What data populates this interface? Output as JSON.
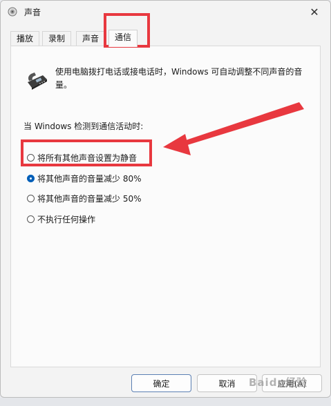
{
  "window": {
    "title": "声音",
    "close_glyph": "✕"
  },
  "tabs": [
    {
      "label": "播放"
    },
    {
      "label": "录制"
    },
    {
      "label": "声音"
    },
    {
      "label": "通信",
      "active": true
    }
  ],
  "panel": {
    "description": "使用电脑拨打电话或接电话时，Windows 可自动调整不同声音的音量。",
    "detect_label": "当 Windows 检测到通信活动时:",
    "options": [
      {
        "label": "将所有其他声音设置为静音",
        "checked": false
      },
      {
        "label": "将其他声音的音量减少 80%",
        "checked": true
      },
      {
        "label": "将其他声音的音量减少 50%",
        "checked": false
      },
      {
        "label": "不执行任何操作",
        "checked": false
      }
    ]
  },
  "buttons": {
    "ok": "确定",
    "cancel": "取消",
    "apply": "应用(A)"
  },
  "watermark": "Baidu经验",
  "colors": {
    "highlight": "#e8383f",
    "accent": "#005fb8"
  }
}
